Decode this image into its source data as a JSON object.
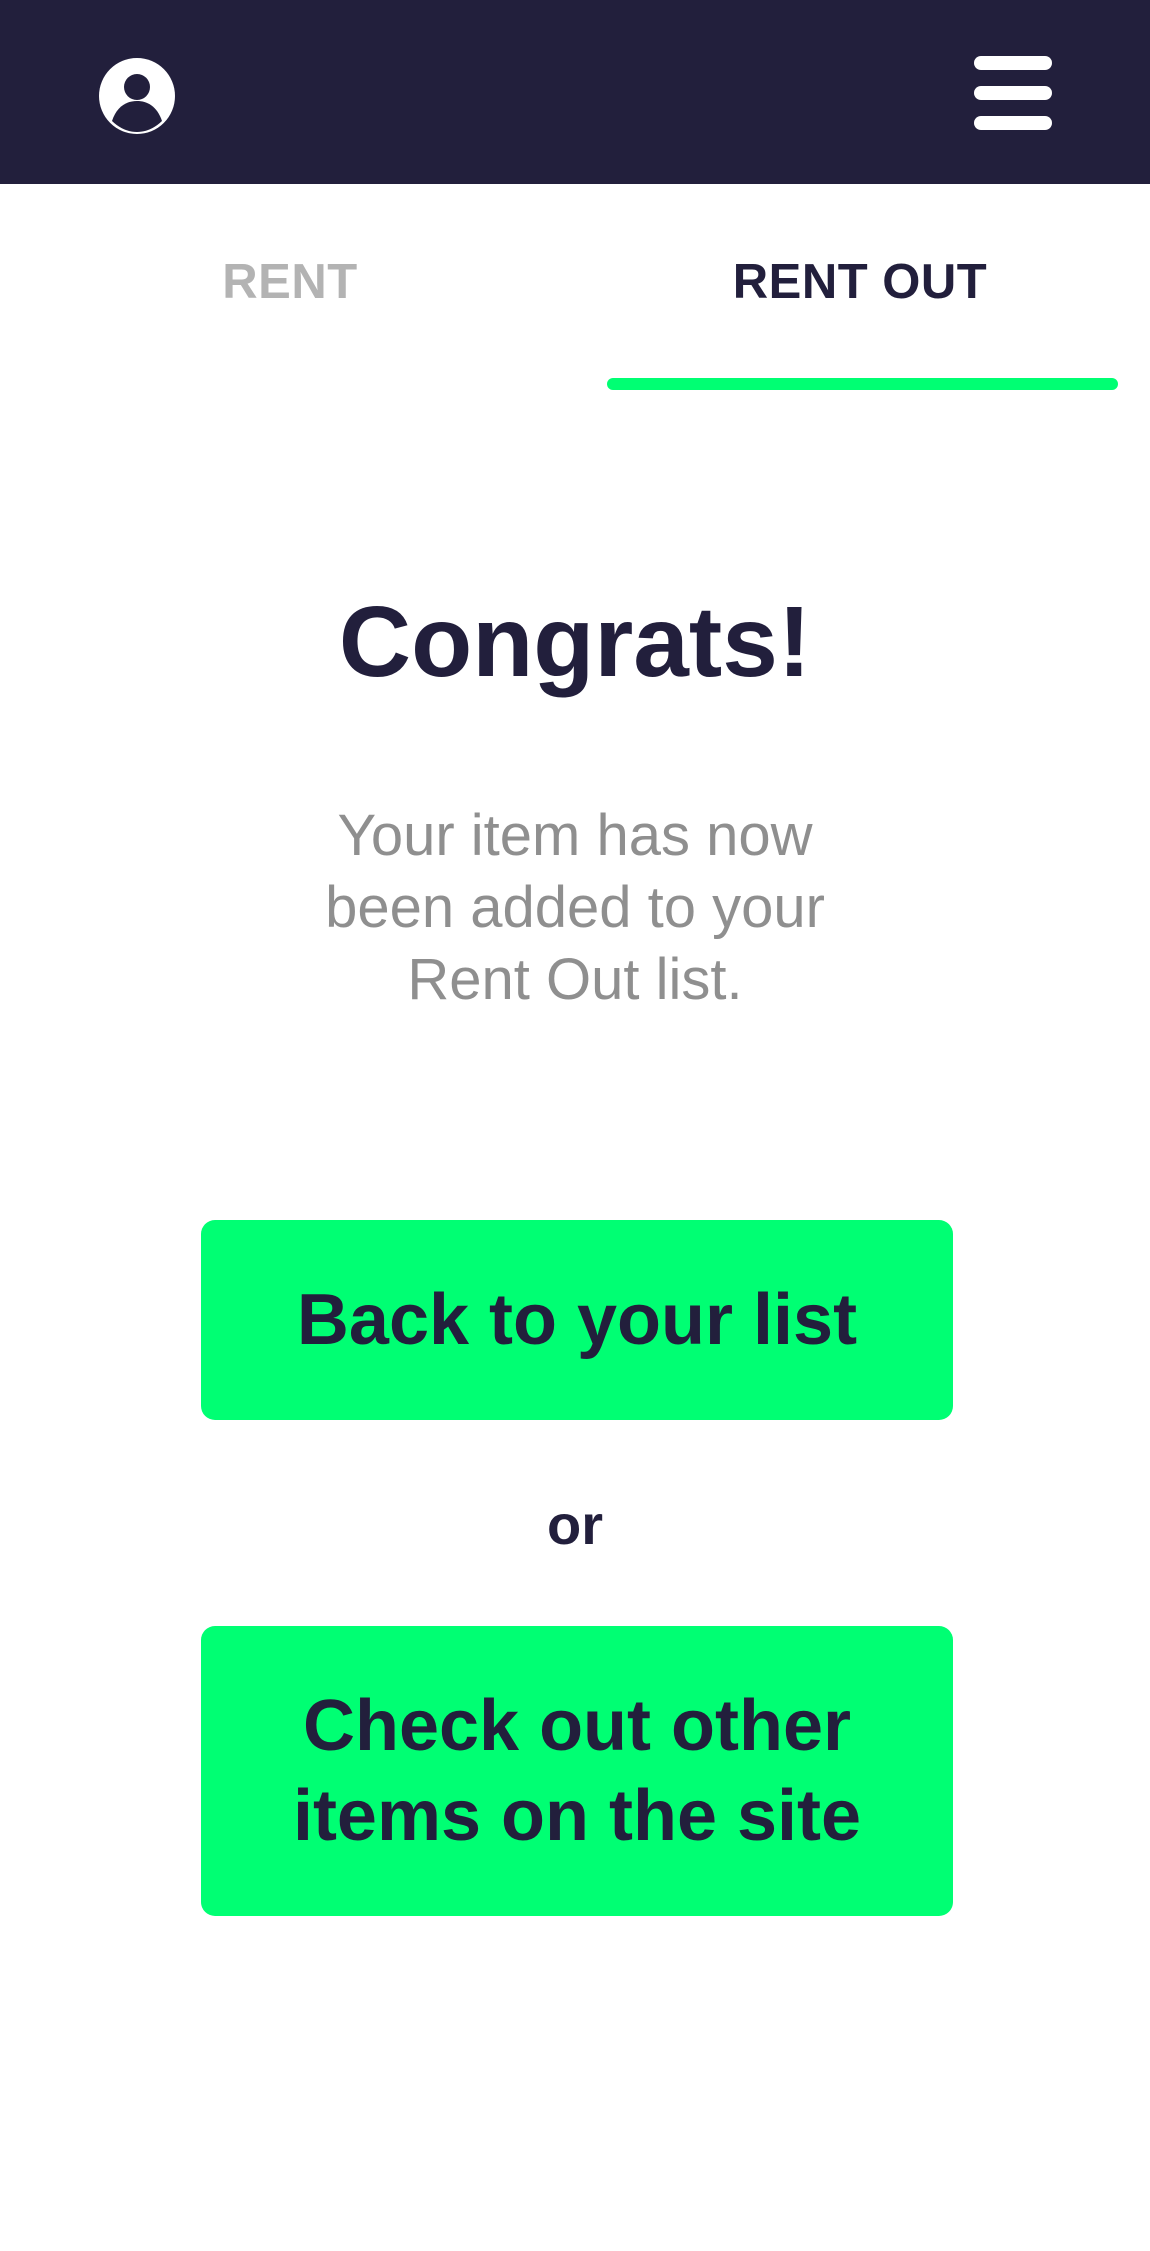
{
  "header": {
    "background": "#221f3c",
    "avatar_icon": "user-circle-icon",
    "menu_icon": "hamburger-menu-icon"
  },
  "tabs": [
    {
      "label": "RENT",
      "active": false,
      "color": "#b3b3b3"
    },
    {
      "label": "RENT OUT",
      "active": true,
      "color": "#221f3c"
    }
  ],
  "accent_color": "#00ff73",
  "main": {
    "title": "Congrats!",
    "message": "Your item has now been added to your Rent Out list.",
    "back_button_label": "Back to your list",
    "separator": "or",
    "browse_button_label": "Check out other items on the site"
  }
}
